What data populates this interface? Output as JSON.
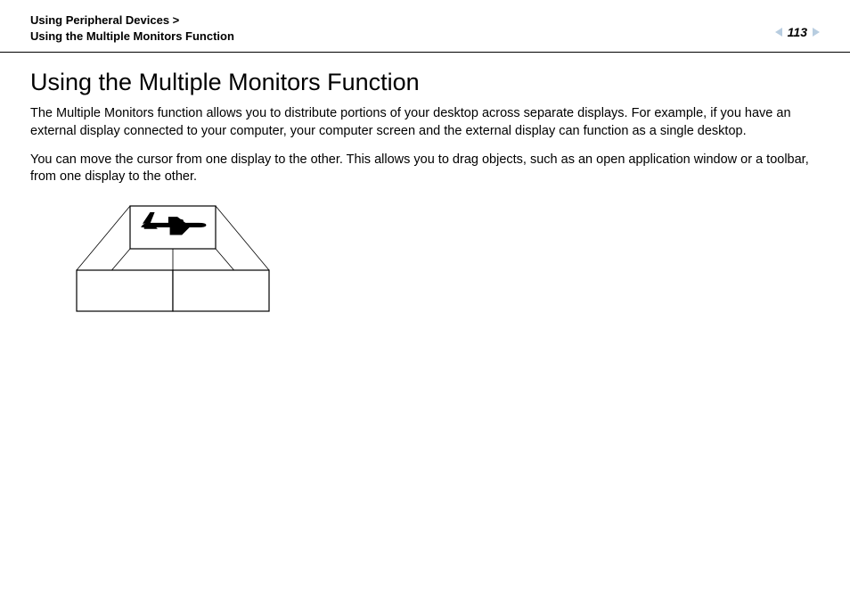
{
  "header": {
    "breadcrumb_line1": "Using Peripheral Devices >",
    "breadcrumb_line2": "Using the Multiple Monitors Function",
    "page_number": "113"
  },
  "body": {
    "title": "Using the Multiple Monitors Function",
    "para1": "The Multiple Monitors function allows you to distribute portions of your desktop across separate displays. For example, if you have an external display connected to your computer, your computer screen and the external display can function as a single desktop.",
    "para2": "You can move the cursor from one display to the other. This allows you to drag objects, such as an open application window or a toolbar, from one display to the other."
  }
}
